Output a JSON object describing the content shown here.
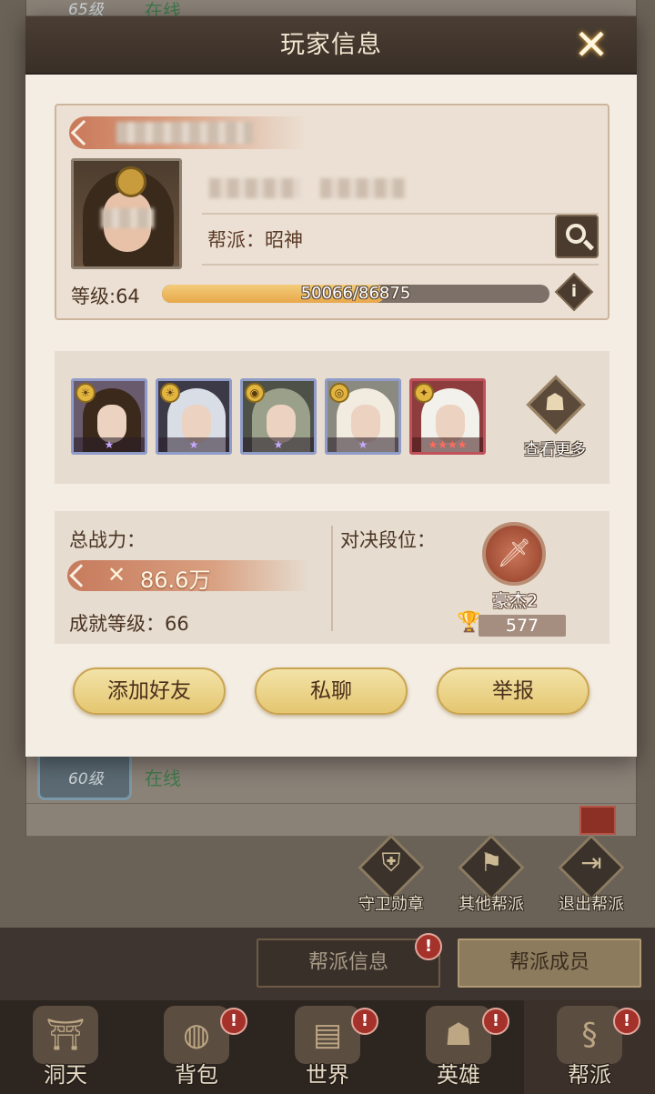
{
  "background": {
    "rows": [
      {
        "level": "65级",
        "status": "在线"
      },
      {
        "level": "60级",
        "status": "在线"
      }
    ],
    "actions": [
      {
        "label": "守卫勋章",
        "icon": "shield-icon"
      },
      {
        "label": "其他帮派",
        "icon": "flag-icon"
      },
      {
        "label": "退出帮派",
        "icon": "exit-door-icon"
      }
    ],
    "guild_tabs": [
      {
        "label": "帮派信息",
        "badge": "!"
      },
      {
        "label": "帮派成员",
        "selected": true
      }
    ],
    "nav": [
      {
        "label": "洞天",
        "icon": "pavilion-icon"
      },
      {
        "label": "背包",
        "icon": "bag-icon",
        "badge": "!"
      },
      {
        "label": "世界",
        "icon": "scroll-icon",
        "badge": "!"
      },
      {
        "label": "英雄",
        "icon": "hat-hero-icon",
        "badge": "!"
      },
      {
        "label": "帮派",
        "icon": "guild-banner-icon",
        "badge": "!",
        "selected": true
      }
    ]
  },
  "popup": {
    "title": "玩家信息",
    "close_glyph": "✕",
    "profile": {
      "guild": "帮派：昭神",
      "level": "等级:64",
      "exp_text": "50066/86875",
      "exp_fraction": 0.576,
      "info_glyph": "i"
    },
    "heroes": {
      "list": [
        {
          "stars": "★",
          "elem": "☀",
          "hair": "#3b2a1c",
          "bg": "#6a5a6e"
        },
        {
          "stars": "★",
          "elem": "☀",
          "hair": "#d9dde6",
          "bg": "#3d3a48"
        },
        {
          "stars": "★",
          "elem": "◉",
          "hair": "#9aa089",
          "bg": "#4d5148"
        },
        {
          "stars": "★",
          "elem": "◎",
          "hair": "#f1ecdf",
          "bg": "#8b8a80"
        },
        {
          "stars": "★★★★",
          "elem": "✦",
          "hair": "#f3f1ec",
          "bg": "#8e3d3e",
          "red": true
        }
      ],
      "more_label": "查看更多"
    },
    "stats": {
      "power_label": "总战力：",
      "power_value": "86.6万",
      "achievement": "成就等级：66",
      "duel_label": "对决段位：",
      "rank_name": "豪杰2",
      "rank_score": "577"
    },
    "buttons": {
      "add_friend": "添加好友",
      "private_chat": "私聊",
      "report": "举报"
    }
  }
}
